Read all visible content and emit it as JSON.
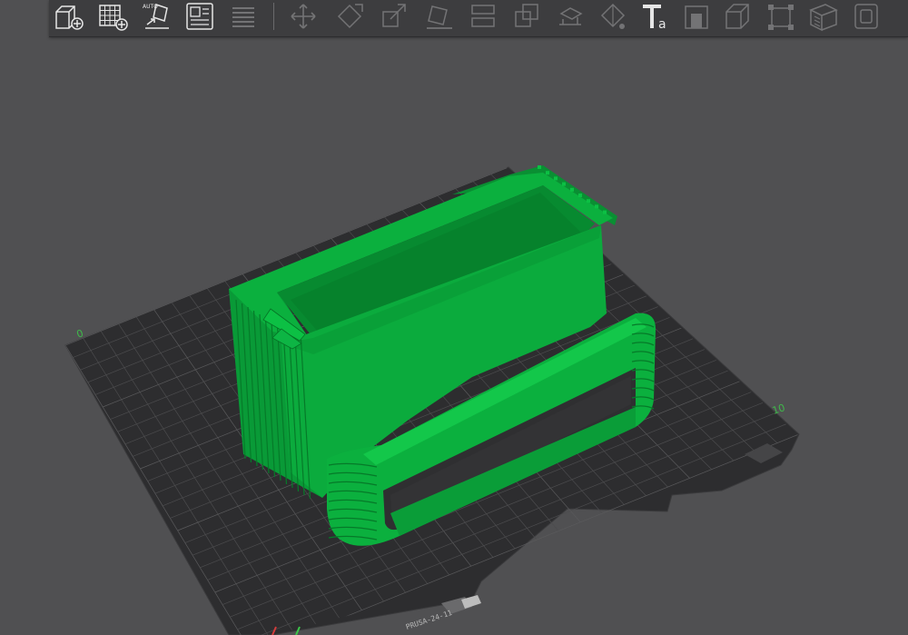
{
  "toolbar": {
    "tools": [
      {
        "name": "add-object-icon",
        "enabled": true
      },
      {
        "name": "add-plate-icon",
        "enabled": true
      },
      {
        "name": "auto-orient-icon",
        "enabled": true,
        "badge": "AUTO"
      },
      {
        "name": "arrange-icon",
        "enabled": true
      },
      {
        "name": "layers-stack-icon",
        "enabled": false
      },
      {
        "name": "move-icon",
        "enabled": false
      },
      {
        "name": "rotate-icon",
        "enabled": false
      },
      {
        "name": "scale-icon",
        "enabled": false
      },
      {
        "name": "lay-on-face-icon",
        "enabled": false
      },
      {
        "name": "split-icon",
        "enabled": false
      },
      {
        "name": "cut-icon",
        "enabled": false
      },
      {
        "name": "support-paint-icon",
        "enabled": false
      },
      {
        "name": "seam-paint-icon",
        "enabled": false
      },
      {
        "name": "color-paint-icon",
        "enabled": false
      },
      {
        "name": "text-tool-icon",
        "enabled": true,
        "badge": "a"
      },
      {
        "name": "measure-icon",
        "enabled": false
      },
      {
        "name": "assembly-view-icon",
        "enabled": false
      },
      {
        "name": "variable-layer-icon",
        "enabled": false
      },
      {
        "name": "sla-supports-icon",
        "enabled": false
      },
      {
        "name": "hollow-icon",
        "enabled": false
      }
    ]
  },
  "bed": {
    "corner_label_left": "0",
    "corner_label_right": "10",
    "plate_tag": "PRUSA-24-11"
  },
  "colors": {
    "background": "#505052",
    "toolbar": "#3d3d3f",
    "bed": "#2f2f31",
    "grid": "#4a4a4c",
    "model": "#09a83a",
    "model_dark": "#067c2a",
    "model_light": "#22c350"
  }
}
